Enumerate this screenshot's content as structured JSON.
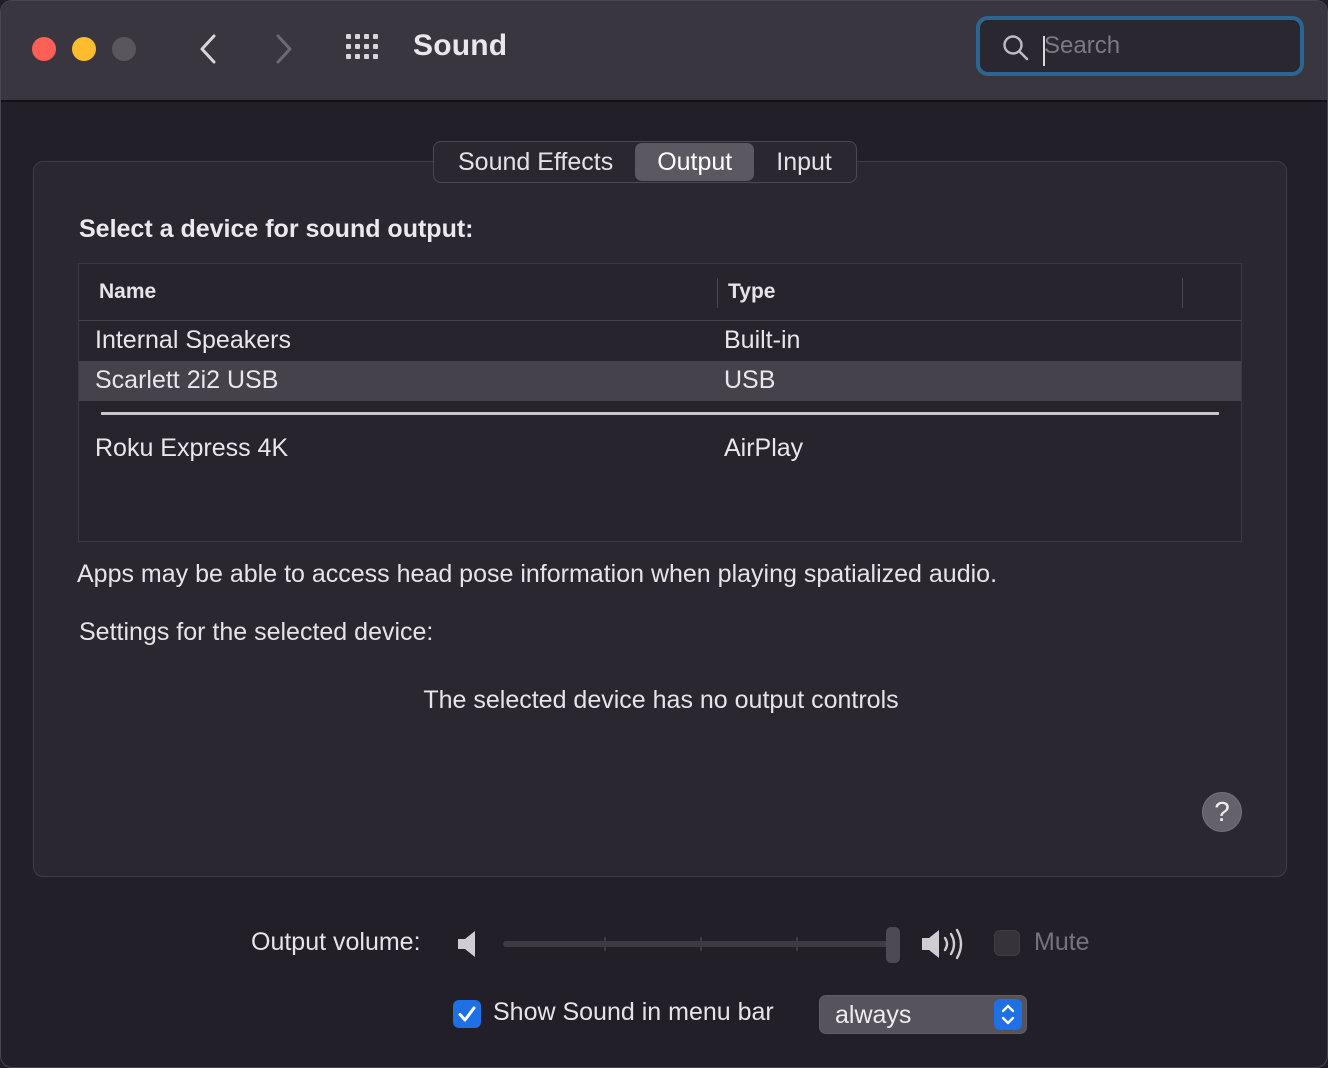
{
  "window": {
    "title": "Sound",
    "search": {
      "placeholder": "Search",
      "value": ""
    }
  },
  "tabs": [
    {
      "label": "Sound Effects",
      "active": false
    },
    {
      "label": "Output",
      "active": true
    },
    {
      "label": "Input",
      "active": false
    }
  ],
  "output": {
    "heading": "Select a device for sound output:",
    "columns": [
      "Name",
      "Type"
    ],
    "devices": [
      {
        "name": "Internal Speakers",
        "type": "Built-in",
        "selected": false
      },
      {
        "name": "Scarlett 2i2 USB",
        "type": "USB",
        "selected": true
      },
      {
        "name": "Roku Express 4K",
        "type": "AirPlay",
        "selected": false
      }
    ],
    "info": "Apps may be able to access head pose information when playing spatialized audio.",
    "settings_label": "Settings for the selected device:",
    "no_controls": "The selected device has no output controls",
    "help_label": "?"
  },
  "bottom": {
    "volume_label": "Output volume:",
    "volume_level": 1.0,
    "mute_label": "Mute",
    "mute_checked": false,
    "show_in_menu_label": "Show Sound in menu bar",
    "show_in_menu_checked": true,
    "menu_bar_option": "always"
  },
  "colors": {
    "accent": "#1f6fe5",
    "close": "#fe5f57",
    "minimize": "#febc2e",
    "search_focus": "#2b6594"
  },
  "icons": [
    "back-chevron-icon",
    "forward-chevron-icon",
    "grid-icon",
    "search-icon",
    "speaker-low-icon",
    "speaker-high-icon",
    "checkmark-icon",
    "up-down-arrows-icon"
  ]
}
